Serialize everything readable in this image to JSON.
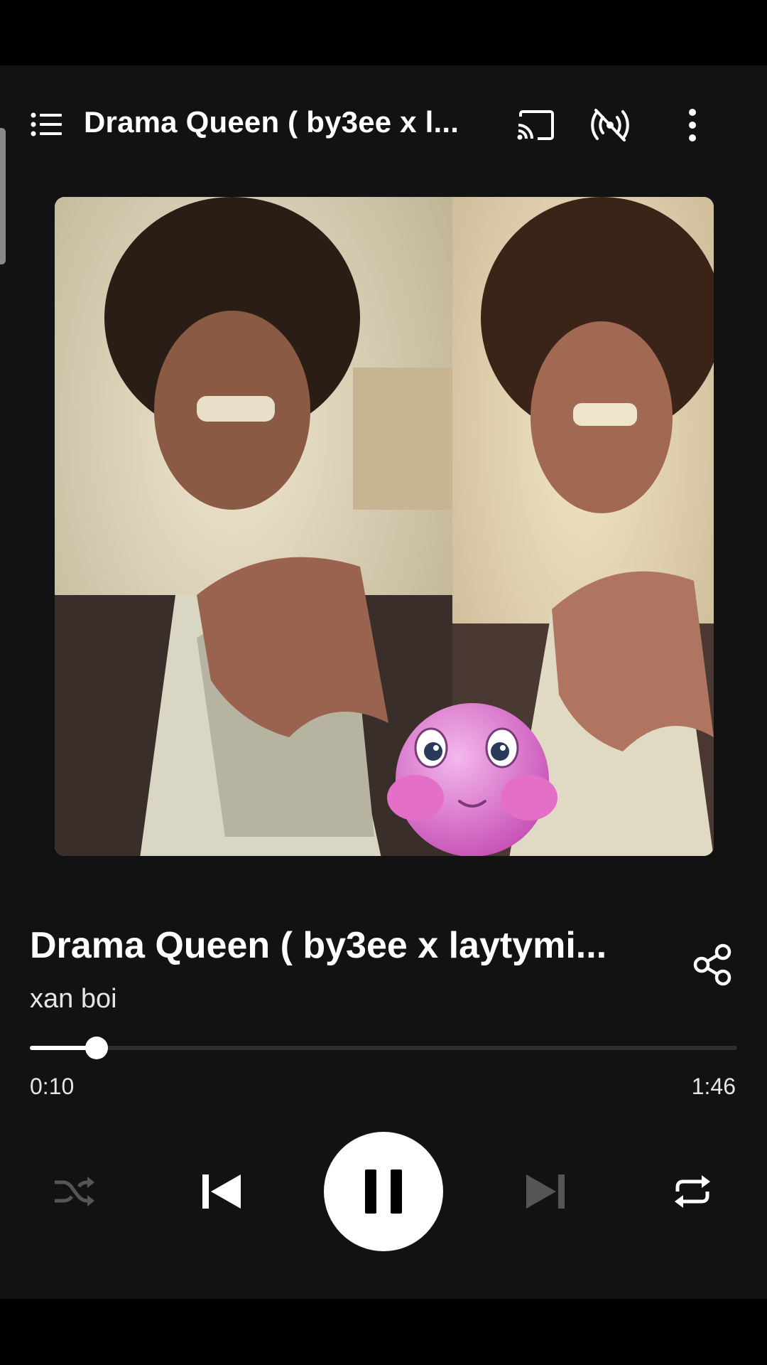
{
  "header": {
    "title": "Drama Queen ( by3ee x l...",
    "icons": [
      "queue-list-icon",
      "cast-icon",
      "wifi-off-icon",
      "more-vert-icon"
    ]
  },
  "album_art": {
    "description_icon": "album-art"
  },
  "track": {
    "title": "Drama Queen ( by3ee x laytymi...",
    "artist": "xan boi"
  },
  "playback": {
    "elapsed": "0:10",
    "total": "1:46",
    "progress_fraction": 0.094,
    "state": "playing"
  },
  "controls": {
    "icons": [
      "shuffle-icon",
      "skip-previous-icon",
      "pause-icon",
      "skip-next-icon",
      "repeat-icon"
    ]
  },
  "colors": {
    "background": "#121212",
    "accent": "#ffffff",
    "disabled": "#555555"
  }
}
